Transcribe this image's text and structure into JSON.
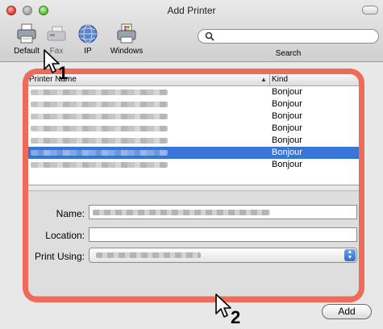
{
  "window": {
    "title": "Add Printer"
  },
  "toolbar": {
    "items": [
      {
        "label": "Default",
        "icon": "printer-icon"
      },
      {
        "label": "Fax",
        "icon": "fax-icon"
      },
      {
        "label": "IP",
        "icon": "globe-icon"
      },
      {
        "label": "Windows",
        "icon": "windows-printer-icon"
      }
    ],
    "search_label": "Search"
  },
  "printer_list": {
    "columns": {
      "name": "Printer Name",
      "kind": "Kind"
    },
    "rows": [
      {
        "kind": "Bonjour",
        "selected": false
      },
      {
        "kind": "Bonjour",
        "selected": false
      },
      {
        "kind": "Bonjour",
        "selected": false
      },
      {
        "kind": "Bonjour",
        "selected": false
      },
      {
        "kind": "Bonjour",
        "selected": false
      },
      {
        "kind": "Bonjour",
        "selected": true
      },
      {
        "kind": "Bonjour",
        "selected": false
      }
    ]
  },
  "form": {
    "name_label": "Name:",
    "location_label": "Location:",
    "print_using_label": "Print Using:"
  },
  "buttons": {
    "add_label": "Add"
  },
  "steps": {
    "first": "1",
    "second": "2"
  },
  "colors": {
    "callout": "#ef6b59",
    "selection": "#3875d7"
  }
}
